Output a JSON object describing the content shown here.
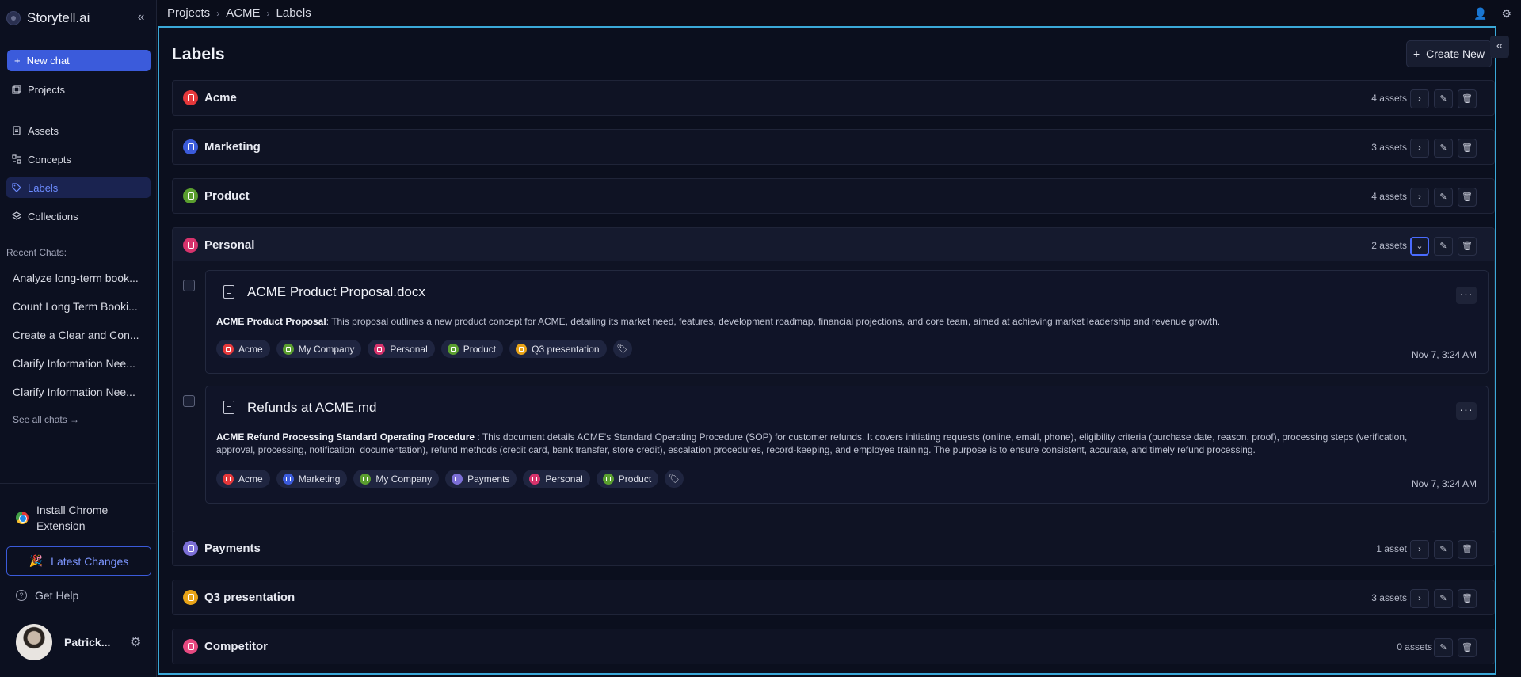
{
  "app": {
    "name": "Storytell.ai"
  },
  "sidebar": {
    "new_chat": "New chat",
    "nav": [
      {
        "label": "Projects",
        "icon": "projects-icon"
      },
      {
        "label": "Assets",
        "icon": "assets-icon"
      },
      {
        "label": "Concepts",
        "icon": "concepts-icon"
      },
      {
        "label": "Labels",
        "icon": "tag-icon"
      },
      {
        "label": "Collections",
        "icon": "layers-icon"
      }
    ],
    "recent_heading": "Recent Chats:",
    "recent": [
      "Analyze long-term book...",
      "Count Long Term Booki...",
      "Create a Clear and Con...",
      "Clarify Information Nee...",
      "Clarify Information Nee..."
    ],
    "see_all": "See all chats →",
    "install_extension": "Install Chrome Extension",
    "latest_changes": "Latest Changes",
    "latest_emoji": "🎉",
    "get_help": "Get Help",
    "user_name": "Patrick..."
  },
  "breadcrumb": [
    "Projects",
    "ACME",
    "Labels"
  ],
  "page": {
    "title": "Labels",
    "create_new": "Create New"
  },
  "labels": [
    {
      "name": "Acme",
      "count": "4 assets",
      "color": "#e5383b"
    },
    {
      "name": "Marketing",
      "count": "3 assets",
      "color": "#3b5bdb"
    },
    {
      "name": "Product",
      "count": "4 assets",
      "color": "#5a9e2f"
    },
    {
      "name": "Personal",
      "count": "2 assets",
      "color": "#d6336c"
    },
    {
      "name": "Payments",
      "count": "1 asset",
      "color": "#7c6fd6"
    },
    {
      "name": "Q3 presentation",
      "count": "3 assets",
      "color": "#e8a317"
    },
    {
      "name": "Competitor",
      "count": "0 assets",
      "color": "#e64980"
    }
  ],
  "assets": [
    {
      "title": "ACME Product Proposal.docx",
      "summary_title": "ACME Product Proposal",
      "summary": ": This proposal outlines a new product concept for ACME, detailing its market need, features, development roadmap, financial projections, and core team, aimed at achieving market leadership and revenue growth.",
      "chips": [
        "Acme",
        "My Company",
        "Personal",
        "Product",
        "Q3 presentation"
      ],
      "date": "Nov 7, 3:24 AM"
    },
    {
      "title": "Refunds at ACME.md",
      "summary_title": "ACME Refund Processing Standard Operating Procedure",
      "summary": " : This document details ACME's Standard Operating Procedure (SOP) for customer refunds. It covers initiating requests (online, email, phone), eligibility criteria (purchase date, reason, proof), processing steps (verification, approval, processing, notification, documentation), refund methods (credit card, bank transfer, store credit), escalation procedures, record-keeping, and employee training. The purpose is to ensure consistent, accurate, and timely refund processing.",
      "chips": [
        "Acme",
        "Marketing",
        "My Company",
        "Payments",
        "Personal",
        "Product"
      ],
      "date": "Nov 7, 3:24 AM"
    }
  ],
  "chip_colors": {
    "Acme": "#e5383b",
    "Marketing": "#3b5bdb",
    "My Company": "#5a9e2f",
    "Payments": "#7c6fd6",
    "Personal": "#d6336c",
    "Product": "#5a9e2f",
    "Q3 presentation": "#e8a317"
  }
}
